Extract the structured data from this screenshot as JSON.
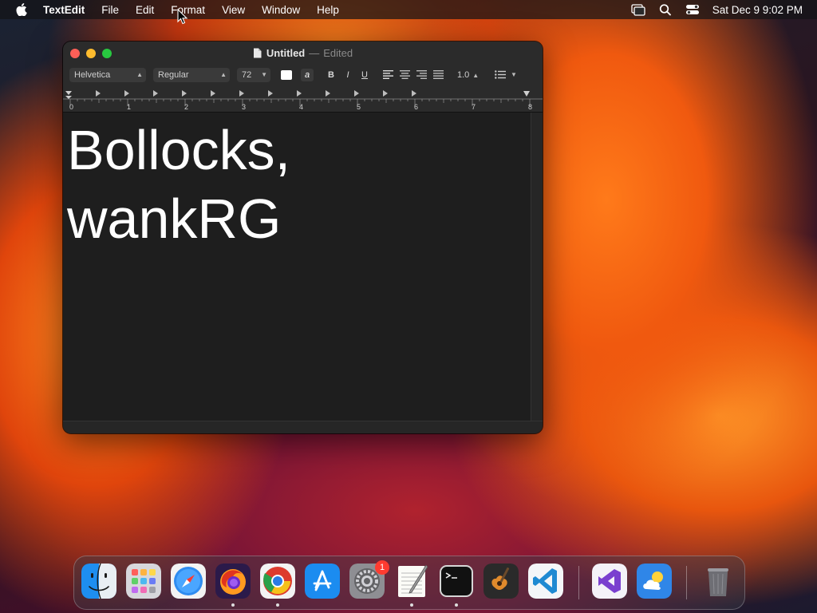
{
  "menubar": {
    "app_name": "TextEdit",
    "items": [
      "File",
      "Edit",
      "Format",
      "View",
      "Window",
      "Help"
    ],
    "clock": "Sat Dec 9  9:02 PM"
  },
  "window": {
    "title": "Untitled",
    "separator": "—",
    "status": "Edited"
  },
  "toolbar": {
    "font_family": "Helvetica",
    "font_style": "Regular",
    "font_size": "72",
    "bold": "B",
    "italic": "I",
    "underline": "U",
    "line_spacing": "1.0",
    "text_bg_glyph": "a"
  },
  "ruler": {
    "labels": [
      "0",
      "1",
      "2",
      "3",
      "4",
      "5",
      "6",
      "7",
      "8"
    ]
  },
  "document": {
    "line1": "Bollocks,",
    "line2": "wankRG"
  },
  "dock": {
    "apps": [
      "finder",
      "launchpad",
      "safari",
      "firefox",
      "chrome",
      "app-store",
      "system-settings",
      "textedit",
      "terminal",
      "garageband",
      "vscode",
      "visual-studio",
      "weather",
      "trash"
    ],
    "settings_badge": "1"
  },
  "colors": {
    "close": "#ff5f57",
    "minimize": "#febc2e",
    "zoom": "#28c840",
    "badge": "#ff3b30"
  }
}
